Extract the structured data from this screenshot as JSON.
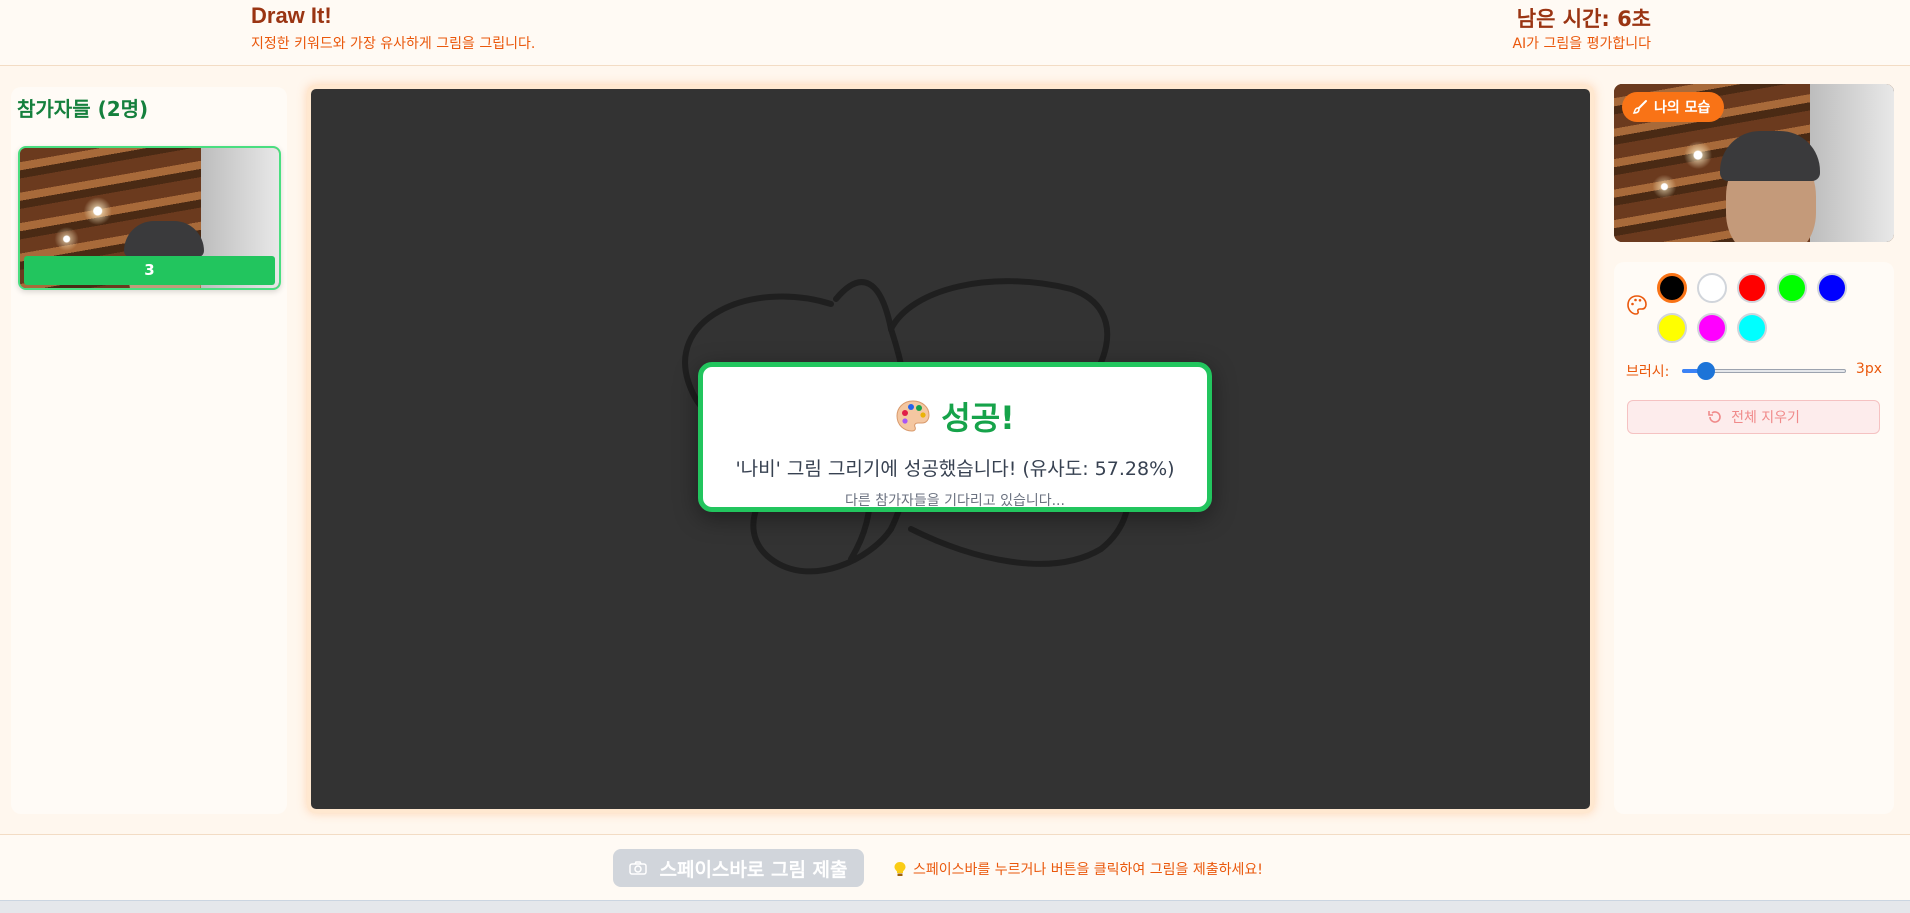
{
  "header": {
    "title": "Draw It!",
    "subtitle": "지정한 키워드와 가장 유사하게 그림을 그립니다.",
    "timer": "남은 시간: 6초",
    "timer_sub": "AI가 그림을 평가합니다"
  },
  "participants": {
    "title": "참가자들 (2명)",
    "list": [
      {
        "score": "3"
      }
    ]
  },
  "modal": {
    "title": "성공!",
    "icon": "palette-emoji",
    "message": "'나비' 그림 그리기에 성공했습니다! (유사도: 57.28%)",
    "wait": "다른 참가자들을 기다리고 있습니다..."
  },
  "self_view": {
    "badge": "나의 모습",
    "icon": "brush-icon"
  },
  "tools": {
    "palette_icon": "palette-icon",
    "colors": [
      "#000000",
      "#ffffff",
      "#ff0000",
      "#00ff00",
      "#0000ff",
      "#ffff00",
      "#ff00ff",
      "#00ffff"
    ],
    "selected_color": "#000000",
    "brush_label": "브러시:",
    "brush_size": 3,
    "brush_min": 1,
    "brush_max": 20,
    "brush_value_text": "3px",
    "clear_label": "전체 지우기"
  },
  "bottom": {
    "submit_label": "스페이스바로 그림 제출",
    "hint": "스페이스바를 누르거나 버튼을 클릭하여 그림을 제출하세요!"
  }
}
